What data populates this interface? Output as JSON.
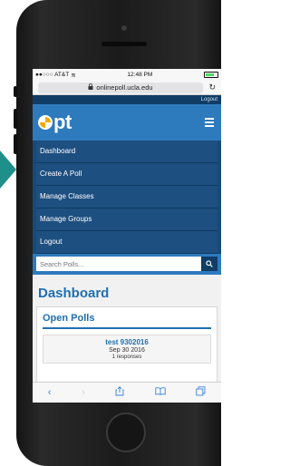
{
  "status_bar": {
    "carrier": "●●○○○ AT&T",
    "wifi_icon": "wifi-icon",
    "time": "12:48 PM"
  },
  "browser": {
    "url": "onlinepoll.ucla.edu",
    "lock_icon": "lock-icon",
    "reload_icon": "reload-icon"
  },
  "site": {
    "top_logout": "Logout",
    "logo": "Opt",
    "menu": [
      "Dashboard",
      "Create A Poll",
      "Manage Classes",
      "Manage Groups",
      "Logout"
    ],
    "search": {
      "placeholder": "Search Polls..."
    }
  },
  "content": {
    "page_title": "Dashboard",
    "section_title": "Open Polls",
    "poll": {
      "name": "test 9302016",
      "date": "Sep 30 2016",
      "responses": "1 responses"
    }
  },
  "colors": {
    "brand": "#2d7bbd",
    "nav_dark": "#174a78",
    "title_blue": "#1f6fb2",
    "accent_teal": "#1f8f8a"
  }
}
